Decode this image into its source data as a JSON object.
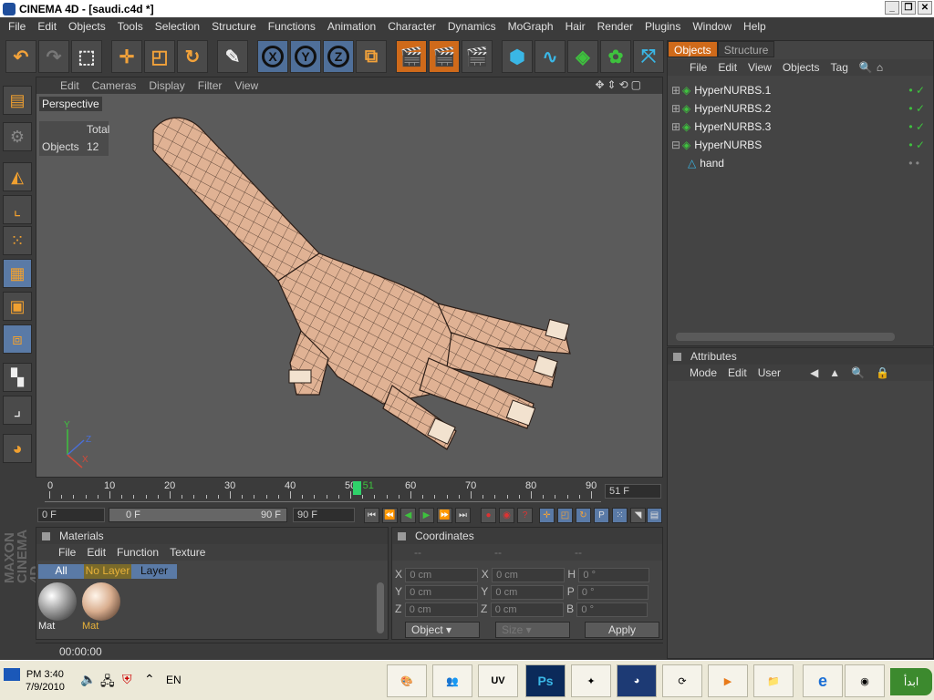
{
  "window": {
    "title": "CINEMA 4D - [saudi.c4d *]"
  },
  "menu": [
    "File",
    "Edit",
    "Objects",
    "Tools",
    "Selection",
    "Structure",
    "Functions",
    "Animation",
    "Character",
    "Dynamics",
    "MoGraph",
    "Hair",
    "Render",
    "Plugins",
    "Window",
    "Help"
  ],
  "toolbar": {
    "axis_x": "X",
    "axis_y": "Y",
    "axis_z": "Z"
  },
  "viewport": {
    "menu": [
      "Edit",
      "Cameras",
      "Display",
      "Filter",
      "View"
    ],
    "label": "Perspective",
    "stats_header": "Total",
    "stats_label": "Objects",
    "stats_value": "12",
    "axis_y": "Y",
    "axis_z": "Z",
    "axis_x": "X"
  },
  "timeline": {
    "ticks": [
      "0",
      "10",
      "20",
      "30",
      "40",
      "50",
      "60",
      "70",
      "80",
      "90"
    ],
    "current_label": "51",
    "current_frame": "51 F",
    "current_value": 51,
    "max": 90,
    "start_field": "0 F",
    "range_start": "0 F",
    "range_end": "90 F",
    "end_field": "90 F"
  },
  "object_manager": {
    "tabs": [
      "Objects",
      "Structure"
    ],
    "menu": [
      "File",
      "Edit",
      "View",
      "Objects",
      "Tag"
    ],
    "items": [
      {
        "name": "HyperNURBS.1",
        "indent": 0
      },
      {
        "name": "HyperNURBS.2",
        "indent": 0
      },
      {
        "name": "HyperNURBS.3",
        "indent": 0
      },
      {
        "name": "HyperNURBS",
        "indent": 0
      },
      {
        "name": "hand",
        "indent": 1
      }
    ]
  },
  "attributes": {
    "title": "Attributes",
    "menu": [
      "Mode",
      "Edit",
      "User"
    ]
  },
  "materials": {
    "title": "Materials",
    "menu": [
      "File",
      "Edit",
      "Function",
      "Texture"
    ],
    "filters": [
      "All",
      "No Layer",
      "Layer"
    ],
    "swatches": [
      {
        "name": "Mat",
        "color": "#9a9a9a"
      },
      {
        "name": "Mat",
        "color": "#d9ae8f"
      }
    ]
  },
  "coordinates": {
    "title": "Coordinates",
    "col_headers": [
      "--",
      "--",
      "--"
    ],
    "rows": [
      {
        "a": "X",
        "av": "0 cm",
        "b": "X",
        "bv": "0 cm",
        "c": "H",
        "cv": "0 °"
      },
      {
        "a": "Y",
        "av": "0 cm",
        "b": "Y",
        "bv": "0 cm",
        "c": "P",
        "cv": "0 °"
      },
      {
        "a": "Z",
        "av": "0 cm",
        "b": "Z",
        "bv": "0 cm",
        "c": "B",
        "cv": "0 °"
      }
    ],
    "mode_select": "Object",
    "size_select": "Size",
    "apply_label": "Apply"
  },
  "status": {
    "time": "00:00:00"
  },
  "taskbar": {
    "clock_time": "PM 3:40",
    "clock_date": "7/9/2010",
    "lang": "EN",
    "uv_label": "UV",
    "ps_label": "Ps",
    "start_label": "ابدأ"
  },
  "colors": {
    "accent_orange": "#f2a23a",
    "selected_blue": "#5a7aa6",
    "mesh_skin": "#e0b294",
    "check_green": "#3ec23e"
  }
}
